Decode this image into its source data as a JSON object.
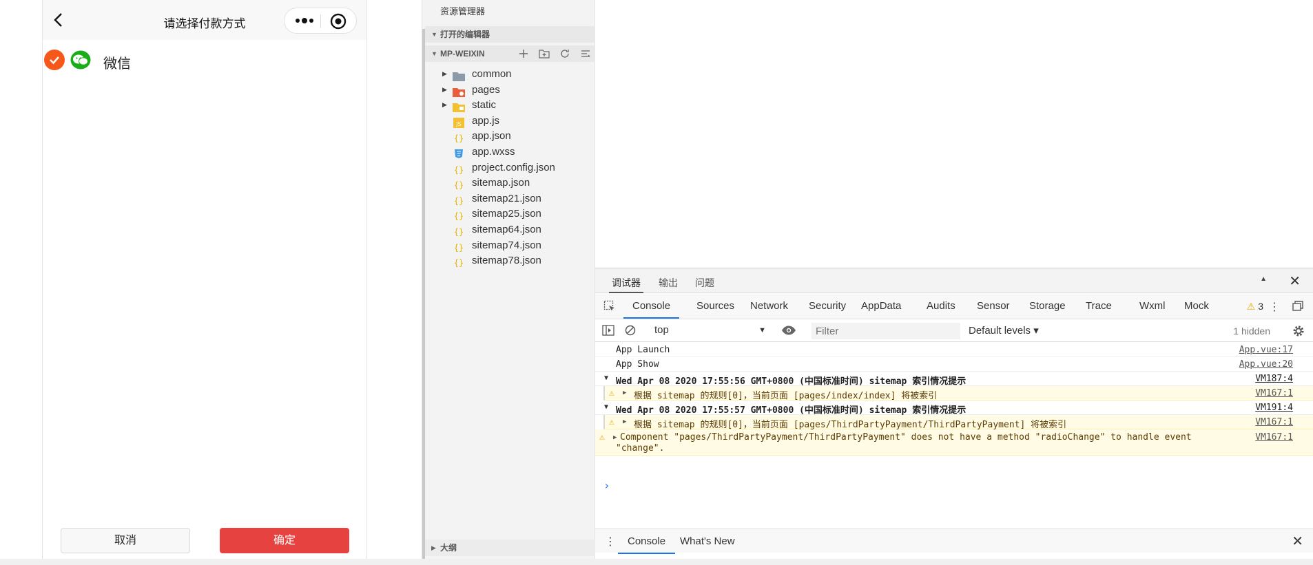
{
  "simulator": {
    "nav_title": "请选择付款方式",
    "payment_option": "微信",
    "cancel_label": "取消",
    "confirm_label": "确定",
    "accent_color": "#f5581a",
    "confirm_color": "#e64340"
  },
  "explorer": {
    "title": "资源管理器",
    "open_editors": "打开的编辑器",
    "project": "MP-WEIXIN",
    "outline": "大纲",
    "tree": [
      {
        "label": "common",
        "icon": "folder-icon"
      },
      {
        "label": "pages",
        "icon": "pages-folder-icon"
      },
      {
        "label": "static",
        "icon": "static-folder-icon"
      },
      {
        "label": "app.js",
        "icon": "js-file-icon"
      },
      {
        "label": "app.json",
        "icon": "json-file-icon"
      },
      {
        "label": "app.wxss",
        "icon": "css-file-icon"
      },
      {
        "label": "project.config.json",
        "icon": "json-file-icon"
      },
      {
        "label": "sitemap.json",
        "icon": "json-file-icon"
      },
      {
        "label": "sitemap21.json",
        "icon": "json-file-icon"
      },
      {
        "label": "sitemap25.json",
        "icon": "json-file-icon"
      },
      {
        "label": "sitemap64.json",
        "icon": "json-file-icon"
      },
      {
        "label": "sitemap74.json",
        "icon": "json-file-icon"
      },
      {
        "label": "sitemap78.json",
        "icon": "json-file-icon"
      }
    ]
  },
  "devtools": {
    "top_tabs": [
      "调试器",
      "输出",
      "问题"
    ],
    "panel_tabs": [
      "Console",
      "Sources",
      "Network",
      "Security",
      "AppData",
      "Audits",
      "Sensor",
      "Storage",
      "Trace",
      "Wxml",
      "Mock"
    ],
    "warning_count": "3",
    "context": "top",
    "filter_placeholder": "Filter",
    "levels": "Default levels",
    "hidden": "1 hidden",
    "messages": [
      {
        "text": "App Launch",
        "source": "App.vue:17"
      },
      {
        "text": "App Show",
        "source": "App.vue:20"
      },
      {
        "text": "Wed Apr 08 2020 17:55:56 GMT+0800 (中国标准时间) sitemap 索引情况提示",
        "source": "VM187:4"
      },
      {
        "text": "根据 sitemap 的规则[0]，当前页面 [pages/index/index] 将被索引",
        "source": "VM167:1"
      },
      {
        "text": "Wed Apr 08 2020 17:55:57 GMT+0800 (中国标准时间) sitemap 索引情况提示",
        "source": "VM191:4"
      },
      {
        "text": "根据 sitemap 的规则[0]，当前页面 [pages/ThirdPartyPayment/ThirdPartyPayment] 将被索引",
        "source": "VM167:1"
      },
      {
        "text": "Component \"pages/ThirdPartyPayment/ThirdPartyPayment\" does not have a method \"radioChange\" to handle event",
        "text2": "\"change\".",
        "source": "VM167:1"
      }
    ],
    "drawer_tabs": [
      "Console",
      "What's New"
    ]
  }
}
